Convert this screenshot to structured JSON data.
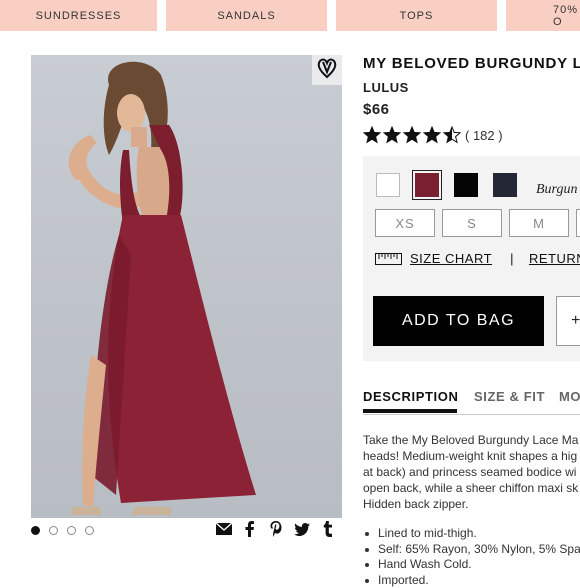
{
  "nav": {
    "items": [
      "SUNDRESSES",
      "SANDALS",
      "TOPS",
      "70% O"
    ]
  },
  "gallery": {
    "icons": {
      "wishlist": "heart-icon",
      "email": "envelope-icon",
      "facebook": "facebook-icon",
      "pinterest": "pinterest-icon",
      "twitter": "twitter-icon",
      "tumblr": "tumblr-icon"
    }
  },
  "product": {
    "title": "MY BELOVED BURGUNDY L",
    "brand": "LULUS",
    "price": "$66",
    "rating": 4.5,
    "rating_count": "( 182 )",
    "selected_color": "Burgun",
    "colors": [
      "#ffffff",
      "#7a1f31",
      "#050505",
      "#232634"
    ],
    "sizes": [
      "XS",
      "S",
      "M"
    ],
    "size_chart": "SIZE CHART",
    "separator": "|",
    "return_link": "RETURN",
    "add_to_bag": "ADD TO BAG",
    "plus": "+"
  },
  "tabs": [
    "DESCRIPTION",
    "SIZE & FIT",
    "MO"
  ],
  "description": {
    "lines": [
      "Take the My Beloved Burgundy Lace Ma",
      "heads! Medium-weight knit shapes a hig",
      "at back) and princess seamed bodice wi",
      "open back, while a sheer chiffon maxi sk",
      "Hidden back zipper."
    ],
    "bullets": [
      "Lined to mid-thigh.",
      "Self: 65% Rayon, 30% Nylon, 5% Span",
      "Hand Wash Cold.",
      "Imported."
    ]
  }
}
